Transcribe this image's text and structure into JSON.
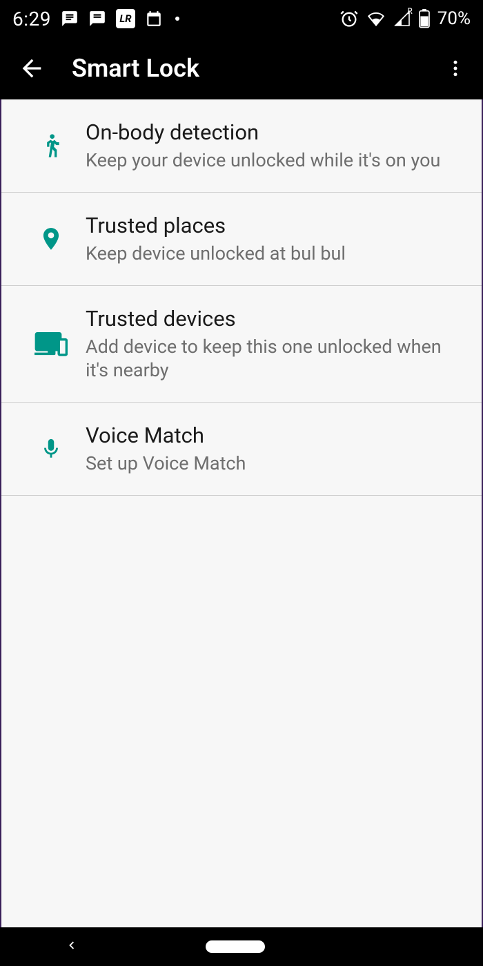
{
  "statusbar": {
    "time": "6:29",
    "battery_text": "70%",
    "roaming_indicator": "R"
  },
  "appbar": {
    "title": "Smart Lock"
  },
  "items": [
    {
      "icon": "walk-icon",
      "title": "On-body detection",
      "subtitle": "Keep your device unlocked while it's on you"
    },
    {
      "icon": "place-icon",
      "title": "Trusted places",
      "subtitle": "Keep device unlocked at bul bul"
    },
    {
      "icon": "devices-icon",
      "title": "Trusted devices",
      "subtitle": "Add device to keep this one unlocked when it's nearby"
    },
    {
      "icon": "mic-icon",
      "title": "Voice Match",
      "subtitle": "Set up Voice Match"
    }
  ]
}
